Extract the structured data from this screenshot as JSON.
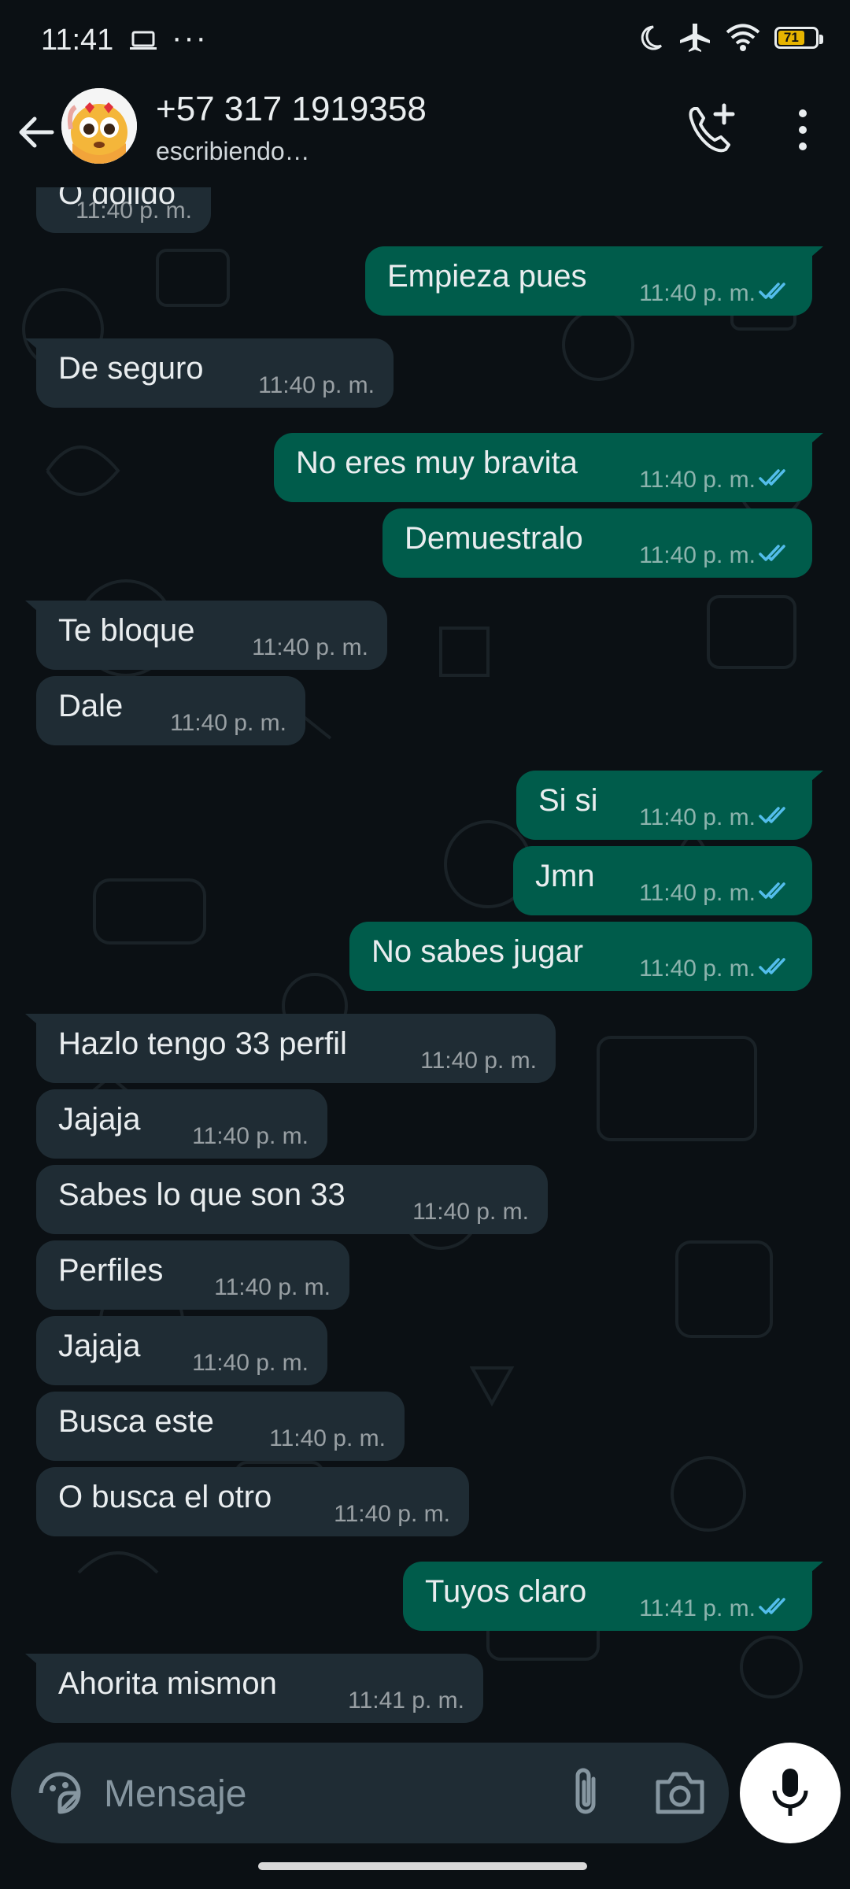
{
  "status_bar": {
    "time": "11:41",
    "battery_level": "71"
  },
  "header": {
    "contact_name": "+57 317 1919358",
    "contact_status": "escribiendo…"
  },
  "messages": [
    {
      "direction": "in",
      "text": "O dolido",
      "time": "11:40 p. m."
    },
    {
      "direction": "out",
      "text": "Empieza pues",
      "time": "11:40 p. m."
    },
    {
      "direction": "in",
      "text": "De seguro",
      "time": "11:40 p. m."
    },
    {
      "direction": "out",
      "text": "No eres muy bravita",
      "time": "11:40 p. m."
    },
    {
      "direction": "out",
      "text": "Demuestralo",
      "time": "11:40 p. m."
    },
    {
      "direction": "in",
      "text": "Te bloque",
      "time": "11:40 p. m."
    },
    {
      "direction": "in",
      "text": "Dale",
      "time": "11:40 p. m."
    },
    {
      "direction": "out",
      "text": "Si si",
      "time": "11:40 p. m."
    },
    {
      "direction": "out",
      "text": "Jmn",
      "time": "11:40 p. m."
    },
    {
      "direction": "out",
      "text": "No sabes jugar",
      "time": "11:40 p. m."
    },
    {
      "direction": "in",
      "text": "Hazlo tengo 33 perfil",
      "time": "11:40 p. m."
    },
    {
      "direction": "in",
      "text": "Jajaja",
      "time": "11:40 p. m."
    },
    {
      "direction": "in",
      "text": "Sabes lo que son 33",
      "time": "11:40 p. m."
    },
    {
      "direction": "in",
      "text": "Perfiles",
      "time": "11:40 p. m."
    },
    {
      "direction": "in",
      "text": "Jajaja",
      "time": "11:40 p. m."
    },
    {
      "direction": "in",
      "text": "Busca este",
      "time": "11:40 p. m."
    },
    {
      "direction": "in",
      "text": "O busca el otro",
      "time": "11:40 p. m."
    },
    {
      "direction": "out",
      "text": "Tuyos claro",
      "time": "11:41 p. m."
    },
    {
      "direction": "in",
      "text": "Ahorita mismon",
      "time": "11:41 p. m."
    }
  ],
  "composer": {
    "placeholder": "Mensaje"
  },
  "colors": {
    "background": "#0b1014",
    "incoming_bubble": "#1f2c34",
    "outgoing_bubble": "#005c4b",
    "read_ticks": "#53bdeb"
  },
  "icons": [
    "back-arrow-icon",
    "add-call-icon",
    "more-vert-icon",
    "sticker-icon",
    "attach-icon",
    "camera-icon",
    "mic-icon",
    "read-ticks-icon"
  ]
}
